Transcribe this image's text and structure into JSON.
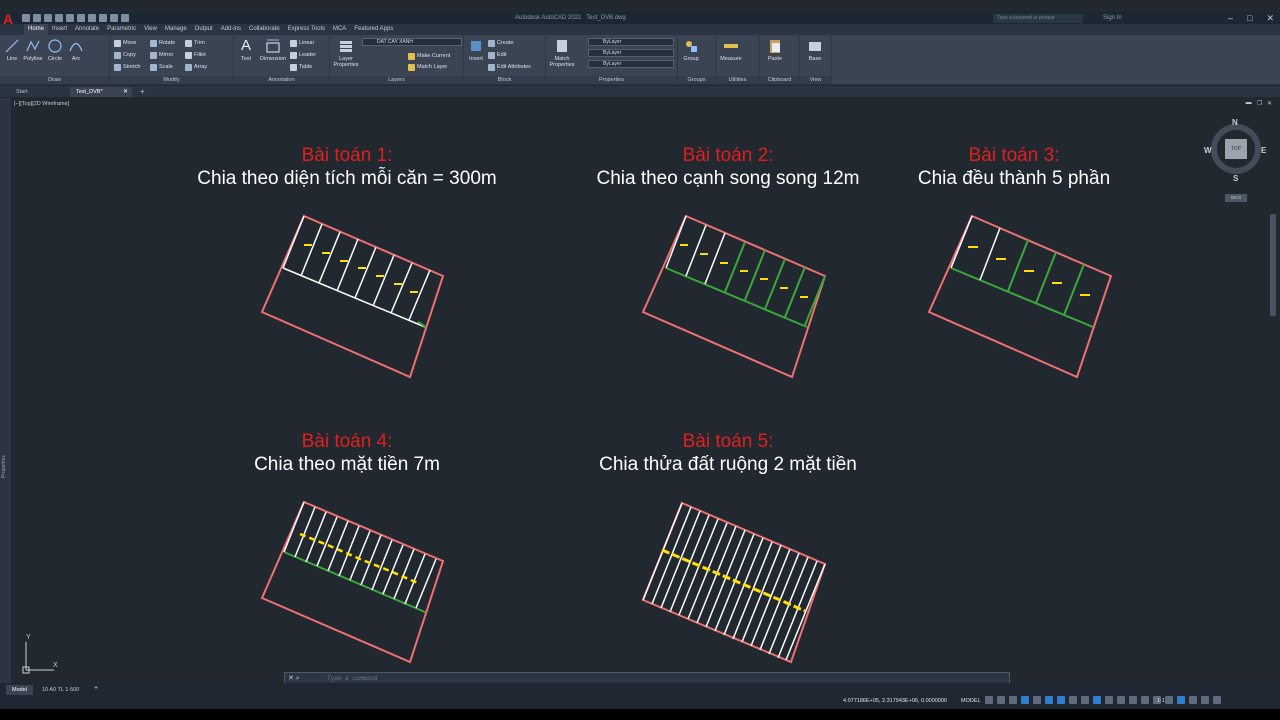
{
  "titlebar": {
    "app_title": "Autodesk AutoCAD 2021",
    "file_name": "Test_DVB.dwg",
    "search_placeholder": "Type a keyword or phrase",
    "signin": "Sign In"
  },
  "ribbon_tabs": [
    "Home",
    "Insert",
    "Annotate",
    "Parametric",
    "View",
    "Manage",
    "Output",
    "Add-ins",
    "Collaborate",
    "Express Tools",
    "MCA",
    "Featured Apps"
  ],
  "ribbon": {
    "draw": {
      "name": "Draw",
      "line": "Line",
      "polyline": "Polyline",
      "circle": "Circle",
      "arc": "Arc"
    },
    "modify": {
      "name": "Modify",
      "move": "Move",
      "rotate": "Rotate",
      "trim": "Trim",
      "copy": "Copy",
      "mirror": "Mirror",
      "fillet": "Fillet",
      "stretch": "Stretch",
      "scale": "Scale",
      "array": "Array"
    },
    "annotation": {
      "name": "Annotation",
      "text": "Text",
      "dimension": "Dimension",
      "linear": "Linear",
      "leader": "Leader",
      "table": "Table"
    },
    "layers": {
      "name": "Layers",
      "layer_properties": "Layer Properties",
      "current_layer": "DAT CAY XANH",
      "make_current": "Make Current",
      "match_layer": "Match Layer"
    },
    "block": {
      "name": "Block",
      "insert": "Insert",
      "create": "Create",
      "edit": "Edit",
      "edit_attributes": "Edit Attributes"
    },
    "properties": {
      "name": "Properties",
      "match_properties": "Match Properties",
      "color": "ByLayer",
      "linetype": "ByLayer",
      "lineweight": "ByLayer"
    },
    "groups": {
      "name": "Groups",
      "group": "Group"
    },
    "utilities": {
      "name": "Utilities",
      "measure": "Measure"
    },
    "clipboard": {
      "name": "Clipboard",
      "paste": "Paste"
    },
    "view": {
      "name": "View",
      "base": "Base"
    }
  },
  "doc_tabs": {
    "start": "Start",
    "active": "Test_DVB*"
  },
  "viewport_label": "[−][Top][2D Wireframe]",
  "left_palette": "Properties",
  "problems": [
    {
      "title": "Bài toán 1:",
      "desc": "Chia theo diện tích mỗi căn = 300m"
    },
    {
      "title": "Bài toán 2:",
      "desc": "Chia theo cạnh song song 12m"
    },
    {
      "title": "Bài toán 3:",
      "desc": "Chia đều thành 5 phần"
    },
    {
      "title": "Bài toán 4:",
      "desc": "Chia theo mặt tiền 7m"
    },
    {
      "title": "Bài toán 5:",
      "desc": "Chia thửa đất ruộng 2 mặt tiền"
    }
  ],
  "viewcube": {
    "top": "TOP",
    "n": "N",
    "s": "S",
    "e": "E",
    "w": "W",
    "wcs": "WCS"
  },
  "ucs": {
    "x": "X",
    "y": "Y"
  },
  "command_placeholder": "Type a command",
  "layout_tabs": {
    "model": "Model",
    "layout": "10 A0 TL 1-500"
  },
  "status": {
    "coords": "4.077186E+05, 2.317943E+06, 0.0000000",
    "model": "MODEL",
    "scale": "1:1"
  },
  "colors": {
    "title_red": "#e0201c",
    "lot_outline": "#f07070",
    "division_white": "#ffffff",
    "green_line": "#3aa83a",
    "yellow_text": "#ffe000",
    "background": "#212830"
  }
}
